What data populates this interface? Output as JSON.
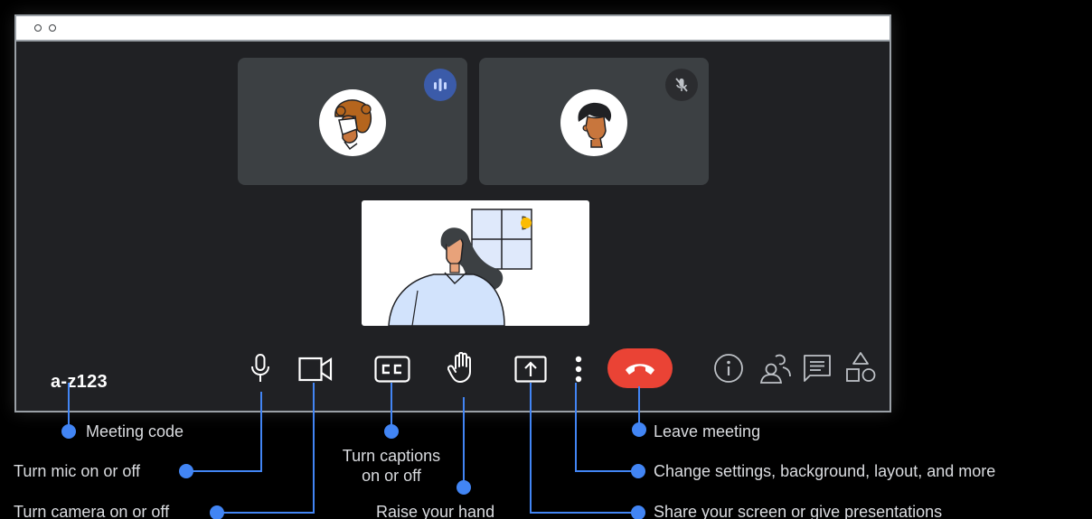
{
  "meeting": {
    "code": "a-z123"
  },
  "controls": {
    "mic": "mic-icon",
    "camera": "camera-icon",
    "captions": "CC",
    "raise_hand": "hand-icon",
    "present": "present-screen-icon",
    "more": "more-vert-icon",
    "leave": "call-end-icon",
    "info": "info-icon",
    "people": "people-icon",
    "chat": "chat-icon",
    "activities": "activities-icon"
  },
  "callouts": {
    "meeting_code": "Meeting code",
    "mic": "Turn mic on or off",
    "camera": "Turn camera on or off",
    "captions_line1": "Turn captions",
    "captions_line2": "on or off",
    "raise_hand": "Raise your hand",
    "leave": "Leave meeting",
    "more": "Change settings, background, layout, and more",
    "present": "Share your screen or give presentations"
  },
  "colors": {
    "accent": "#4285f4",
    "leave_red": "#ea4335",
    "speaking_badge": "#3b5ba9",
    "tile_bg": "#3c4043",
    "window_bg": "#202124"
  }
}
